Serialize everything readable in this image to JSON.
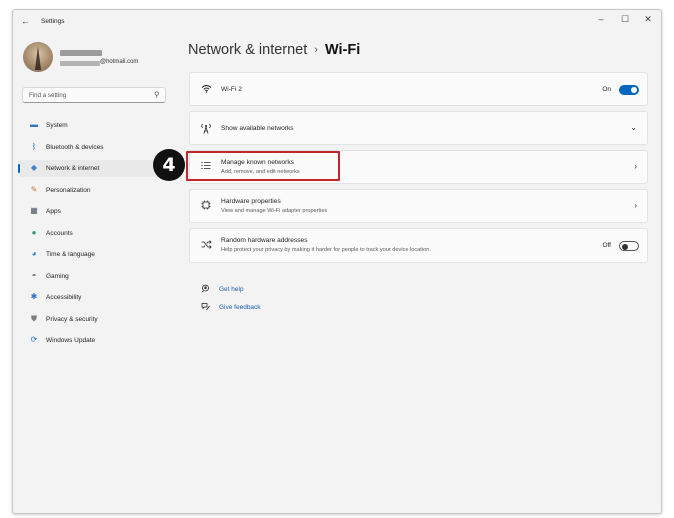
{
  "window": {
    "title": "Settings",
    "back_icon": "←",
    "controls": {
      "minimize": "–",
      "maximize": "☐",
      "close": "✕"
    }
  },
  "profile": {
    "email_suffix": "@hotmail.com"
  },
  "search": {
    "placeholder": "Find a setting",
    "icon": "⚲"
  },
  "sidebar": {
    "items": [
      {
        "label": "System",
        "icon": "system-icon",
        "glyph": "▬",
        "color": "#2e74c9",
        "active": false
      },
      {
        "label": "Bluetooth & devices",
        "icon": "bluetooth-icon",
        "glyph": "ᛒ",
        "color": "#1f6fd1",
        "active": false
      },
      {
        "label": "Network & internet",
        "icon": "wifi-icon",
        "glyph": "◆",
        "color": "#3a83d4",
        "active": true
      },
      {
        "label": "Personalization",
        "icon": "brush-icon",
        "glyph": "✎",
        "color": "#c07a2a",
        "active": false
      },
      {
        "label": "Apps",
        "icon": "apps-icon",
        "glyph": "▦",
        "color": "#4a5568",
        "active": false
      },
      {
        "label": "Accounts",
        "icon": "person-icon",
        "glyph": "●",
        "color": "#2a9d6a",
        "active": false
      },
      {
        "label": "Time & language",
        "icon": "globe-clock-icon",
        "glyph": "◕",
        "color": "#2d7dd2",
        "active": false
      },
      {
        "label": "Gaming",
        "icon": "gamepad-icon",
        "glyph": "◓",
        "color": "#6a6a6a",
        "active": false
      },
      {
        "label": "Accessibility",
        "icon": "accessibility-icon",
        "glyph": "✱",
        "color": "#1f6fd1",
        "active": false
      },
      {
        "label": "Privacy & security",
        "icon": "shield-icon",
        "glyph": "⛊",
        "color": "#7d7d7d",
        "active": false
      },
      {
        "label": "Windows Update",
        "icon": "update-icon",
        "glyph": "⟳",
        "color": "#1f6fd1",
        "active": false
      }
    ]
  },
  "header": {
    "parent": "Network & internet",
    "separator": "›",
    "current": "Wi-Fi"
  },
  "cards": {
    "wifi": {
      "title": "Wi-Fi 2",
      "state": "On",
      "icon": "wifi-icon",
      "glyph": "📶"
    },
    "available": {
      "title": "Show available networks",
      "icon": "antenna-icon",
      "glyph": "🝙",
      "chevron": "⌄"
    },
    "known": {
      "title": "Manage known networks",
      "desc": "Add, remove, and edit networks",
      "icon": "list-icon",
      "glyph": "☰",
      "chevron": "›"
    },
    "hardware": {
      "title": "Hardware properties",
      "desc": "View and manage Wi-Fi adapter properties",
      "icon": "chip-icon",
      "glyph": "▣",
      "chevron": "›"
    },
    "random": {
      "title": "Random hardware addresses",
      "desc": "Help protect your privacy by making it harder for people to track your device location.",
      "state": "Off",
      "icon": "shuffle-icon",
      "glyph": "⤨"
    }
  },
  "step": {
    "number": "4",
    "color": "#c0262d"
  },
  "links": {
    "help": {
      "label": "Get help",
      "icon": "help-icon",
      "glyph": "☎"
    },
    "feedback": {
      "label": "Give feedback",
      "icon": "feedback-icon",
      "glyph": "✉"
    }
  }
}
